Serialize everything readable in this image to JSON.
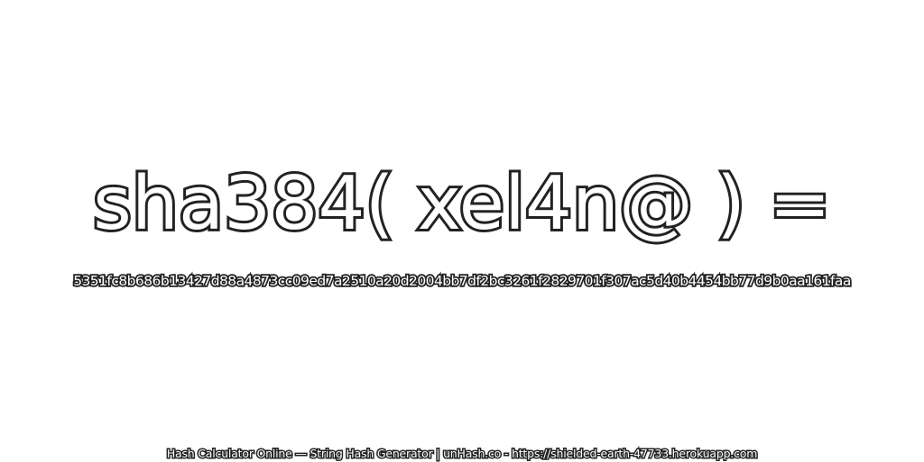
{
  "headline": "sha384( xel4n@ ) =",
  "hash_value": "5351fc8b686b13427d88a4873cc09ed7a2510a20d2004bb7df2bc3261f2829701f307ac5d40b4454bb77d9b0aa161faa",
  "footer_text": "Hash Calculator Online — String Hash Generator | unHash.co - https://shielded-earth-47733.herokuapp.com",
  "colors": {
    "background": "#ffffff",
    "text_fill": "#ffffff",
    "text_outline": "#222222"
  }
}
